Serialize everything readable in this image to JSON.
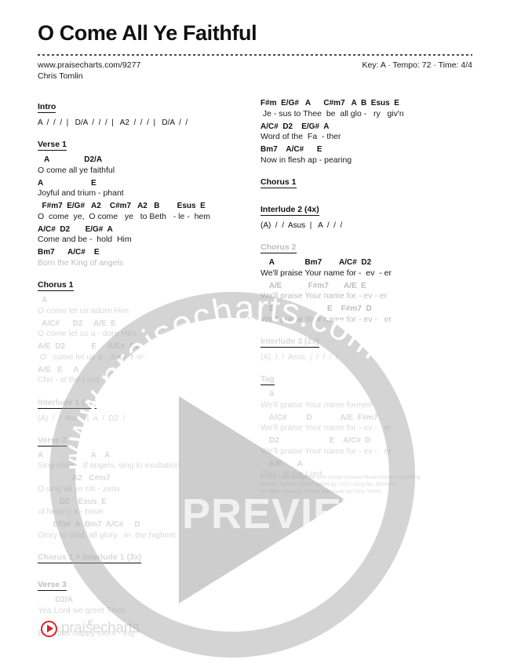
{
  "header": {
    "title": "O Come All Ye Faithful",
    "site_url": "www.praisecharts.com/9277",
    "artist": "Chris Tomlin",
    "key_info": "Key: A · Tempo: 72 · Time: 4/4"
  },
  "left_column": [
    {
      "heading": "Intro",
      "lines": [
        {
          "type": "bars",
          "text": "A  /  /  /  |   D/A  /  /  /  |   A2  /  /  /  |   D/A  /  /"
        }
      ]
    },
    {
      "heading": "Verse 1",
      "lines": [
        {
          "type": "chords",
          "text": "   A                D2/A"
        },
        {
          "type": "lyrics",
          "text": "O come all ye faithful"
        },
        {
          "type": "chords",
          "text": "A                      E"
        },
        {
          "type": "lyrics",
          "text": "Joyful and trium - phant"
        },
        {
          "type": "chords",
          "text": "  F#m7  E/G#   A2    C#m7   A2   B        Esus  E"
        },
        {
          "type": "lyrics",
          "text": "O  come  ye,  O come   ye   to Beth   - le -  hem"
        },
        {
          "type": "chords",
          "text": "A/C#  D2       E/G#  A"
        },
        {
          "type": "lyrics",
          "text": "Come and be -  hold  Him"
        },
        {
          "type": "chords",
          "text": "Bm7      A/C#    E"
        },
        {
          "type": "lyrics",
          "text": "Born the King of angels"
        }
      ]
    },
    {
      "heading": "Chorus 1",
      "lines": [
        {
          "type": "chords",
          "text": "  A"
        },
        {
          "type": "lyrics",
          "text": "O come let us adore Him"
        },
        {
          "type": "chords",
          "text": "  A/C#      D2     A/E  E"
        },
        {
          "type": "lyrics",
          "text": "O come let us a - dore Him"
        },
        {
          "type": "chords",
          "text": "A/E  D2            E     A/C#  D2"
        },
        {
          "type": "lyrics",
          "text": " O   come let us a - dore  Him"
        },
        {
          "type": "chords",
          "text": "A/E   E     A"
        },
        {
          "type": "lyrics",
          "text": "Chri - st the Lord"
        }
      ]
    },
    {
      "heading": "Interlude 1 (2x)",
      "lines": [
        {
          "type": "bars",
          "text": "(A)  /  /  Asus  |  A  /  D2  /"
        }
      ]
    },
    {
      "heading": "Verse 2",
      "lines": [
        {
          "type": "chords",
          "text": "A                      A    A"
        },
        {
          "type": "lyrics",
          "text": "Sing choirs of angels, sing in exultation"
        },
        {
          "type": "chords",
          "text": "                A2   C#m7"
        },
        {
          "type": "lyrics",
          "text": "O sing all ye citi - zens"
        },
        {
          "type": "chords",
          "text": "          D2    Esus  E"
        },
        {
          "type": "lyrics",
          "text": "of heav'n a - bove"
        },
        {
          "type": "chords",
          "text": "       E/G#  A  Bm7  A/C#     D"
        },
        {
          "type": "lyrics",
          "text": "Glory to God, all glory   in  the highest"
        }
      ]
    },
    {
      "heading": "Chorus 1  >  Interlude 1 (3x)",
      "lines": []
    },
    {
      "heading": "Verse 3",
      "lines": [
        {
          "type": "chords",
          "text": "        D2/A"
        },
        {
          "type": "lyrics",
          "text": "Yea Lord we greet Thee"
        },
        {
          "type": "chords",
          "text": "                       E"
        },
        {
          "type": "lyrics",
          "text": "Born this happy morn - ing"
        }
      ]
    }
  ],
  "right_column": [
    {
      "heading": "",
      "lines": [
        {
          "type": "chords",
          "text": "F#m  E/G#   A      C#m7   A  B  Esus  E"
        },
        {
          "type": "lyrics",
          "text": " Je - sus to Thee  be  all glo -   ry   giv'n"
        },
        {
          "type": "chords",
          "text": "A/C#  D2    E/G#  A"
        },
        {
          "type": "lyrics",
          "text": "Word of the  Fa  - ther"
        },
        {
          "type": "chords",
          "text": "Bm7    A/C#      E"
        },
        {
          "type": "lyrics",
          "text": "Now in flesh ap - pearing"
        }
      ]
    },
    {
      "heading": "Chorus 1",
      "lines": []
    },
    {
      "heading": "Interlude 2 (4x)",
      "lines": [
        {
          "type": "bars",
          "text": "(A)  /  /  Asus  |   A  /  /  /"
        }
      ]
    },
    {
      "heading": "Chorus 2",
      "lines": [
        {
          "type": "chords",
          "text": "    A              Bm7        A/C#  D2"
        },
        {
          "type": "lyrics",
          "text": "We'll praise Your name for -  ev  - er"
        },
        {
          "type": "chords",
          "text": "    A/E            F#m7       A/E  E"
        },
        {
          "type": "lyrics",
          "text": "We'll praise Your name for - ev - er"
        },
        {
          "type": "chords",
          "text": "    D                        E    F#m7  D"
        },
        {
          "type": "lyrics",
          "text": "We'll praise Your name for - ev -   er"
        }
      ]
    },
    {
      "heading": "Interlude 3 (2x)",
      "lines": [
        {
          "type": "bars",
          "text": "(A)  /  /  Asus  |  /  /  /  /"
        }
      ]
    },
    {
      "heading": "Tag",
      "lines": [
        {
          "type": "chords",
          "text": "    A"
        },
        {
          "type": "lyrics",
          "text": "We'll praise Your name forever"
        },
        {
          "type": "chords",
          "text": "    A/C#         D             A/E  F#m7"
        },
        {
          "type": "lyrics",
          "text": "We'll praise Your name for - ev -   er"
        },
        {
          "type": "chords",
          "text": "    D2                       E    A/C#  D"
        },
        {
          "type": "lyrics",
          "text": "We'll praise Your name for - ev -   er"
        },
        {
          "type": "chords",
          "text": "    A/E       A"
        },
        {
          "type": "lyrics",
          "text": "Chri - st the Lord"
        }
      ]
    }
  ],
  "copyright": {
    "line1": "© 2006 worshiptogether.com Songs/sixsteps Music/Vamos Publishing",
    "line2": "(Admin. by EMI CMG Publishing). CCLI Song No. 5606949.",
    "line3": "All rights reserved. Words and music by Chris Tomlin."
  },
  "overlay": {
    "preview_label": "PREVIEW",
    "watermark_text": "www.praisecharts.com",
    "play_icon": "play-triangle-icon"
  },
  "footer": {
    "logo_text": "praisecharts",
    "play_icon": "play-circle-icon"
  },
  "colors": {
    "brand_red": "#d8232a",
    "text": "#111111",
    "overlay_gray": "rgba(160,160,160,0.5)"
  }
}
